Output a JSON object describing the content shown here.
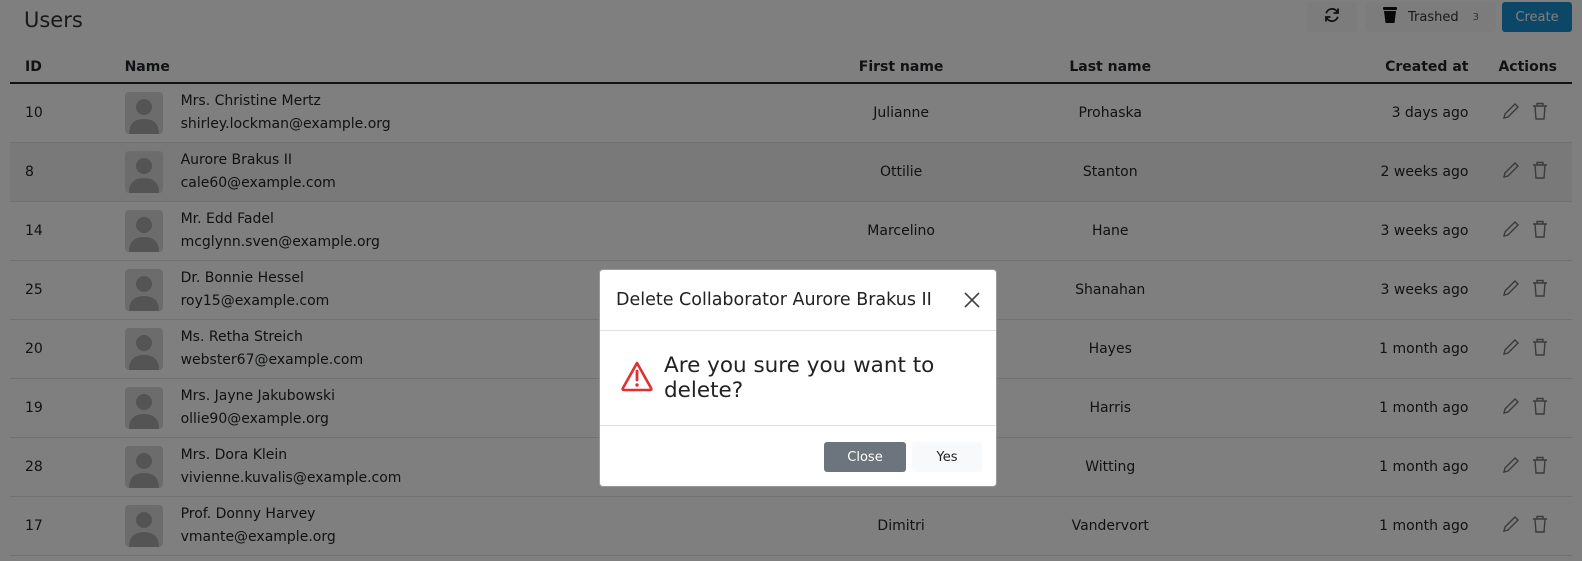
{
  "page": {
    "title": "Users"
  },
  "toolbar": {
    "refresh_icon": "refresh-icon",
    "trashed_icon": "trash-bin-icon",
    "trashed_label": "Trashed",
    "trashed_count": "3",
    "create_label": "Create",
    "create_color": "#1a8fd1"
  },
  "table": {
    "headers": {
      "id": "ID",
      "name": "Name",
      "first_name": "First name",
      "last_name": "Last name",
      "created_at": "Created at",
      "actions": "Actions"
    },
    "rows": [
      {
        "id": "10",
        "name": "Mrs. Christine Mertz",
        "email": "shirley.lockman@example.org",
        "first_name": "Julianne",
        "last_name": "Prohaska",
        "created_at": "3 days ago"
      },
      {
        "id": "8",
        "name": "Aurore Brakus II",
        "email": "cale60@example.com",
        "first_name": "Ottilie",
        "last_name": "Stanton",
        "created_at": "2 weeks ago"
      },
      {
        "id": "14",
        "name": "Mr. Edd Fadel",
        "email": "mcglynn.sven@example.org",
        "first_name": "Marcelino",
        "last_name": "Hane",
        "created_at": "3 weeks ago"
      },
      {
        "id": "25",
        "name": "Dr. Bonnie Hessel",
        "email": "roy15@example.com",
        "first_name": "",
        "last_name": "Shanahan",
        "created_at": "3 weeks ago"
      },
      {
        "id": "20",
        "name": "Ms. Retha Streich",
        "email": "webster67@example.com",
        "first_name": "",
        "last_name": "Hayes",
        "created_at": "1 month ago"
      },
      {
        "id": "19",
        "name": "Mrs. Jayne Jakubowski",
        "email": "ollie90@example.org",
        "first_name": "",
        "last_name": "Harris",
        "created_at": "1 month ago"
      },
      {
        "id": "28",
        "name": "Mrs. Dora Klein",
        "email": "vivienne.kuvalis@example.com",
        "first_name": "",
        "last_name": "Witting",
        "created_at": "1 month ago"
      },
      {
        "id": "17",
        "name": "Prof. Donny Harvey",
        "email": "vmante@example.org",
        "first_name": "Dimitri",
        "last_name": "Vandervort",
        "created_at": "1 month ago"
      }
    ]
  },
  "modal": {
    "title": "Delete Collaborator Aurore Brakus II",
    "message": "Are you sure you want to delete?",
    "warning_icon": "warning-triangle-icon",
    "warning_color": "#e03030",
    "close_label": "Close",
    "yes_label": "Yes",
    "close_color": "#6c757d"
  }
}
